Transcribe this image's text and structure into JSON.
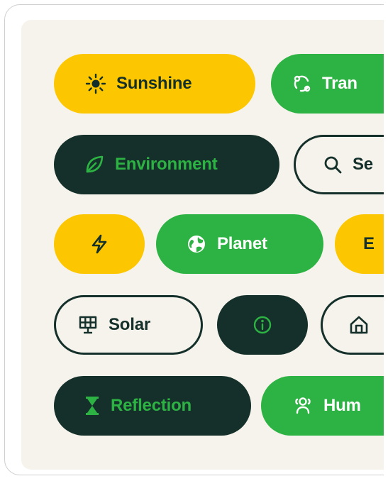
{
  "chips": [
    {
      "id": "sunshine",
      "label": "Sunshine",
      "icon": "sun-icon",
      "style": "yellow"
    },
    {
      "id": "transport",
      "label": "Tran",
      "icon": "recycle-icon",
      "style": "green"
    },
    {
      "id": "environment",
      "label": "Environment",
      "icon": "leaf-icon",
      "style": "dark"
    },
    {
      "id": "search",
      "label": "Se",
      "icon": "search-icon",
      "style": "outline"
    },
    {
      "id": "energy",
      "label": "",
      "icon": "lightning-icon",
      "style": "yellow"
    },
    {
      "id": "planet",
      "label": "Planet",
      "icon": "globe-icon",
      "style": "green"
    },
    {
      "id": "en",
      "label": "E",
      "icon": "",
      "style": "yellow"
    },
    {
      "id": "solar",
      "label": "Solar",
      "icon": "solar-panel-icon",
      "style": "outline"
    },
    {
      "id": "info",
      "label": "",
      "icon": "info-icon",
      "style": "dark"
    },
    {
      "id": "home",
      "label": "",
      "icon": "home-icon",
      "style": "outline"
    },
    {
      "id": "reflection",
      "label": "Reflection",
      "icon": "hourglass-icon",
      "style": "dark"
    },
    {
      "id": "human",
      "label": "Hum",
      "icon": "people-icon",
      "style": "green"
    }
  ],
  "colors": {
    "yellow": "#fcc700",
    "green": "#2db343",
    "dark": "#15302a",
    "panel": "#f6f3ec"
  }
}
